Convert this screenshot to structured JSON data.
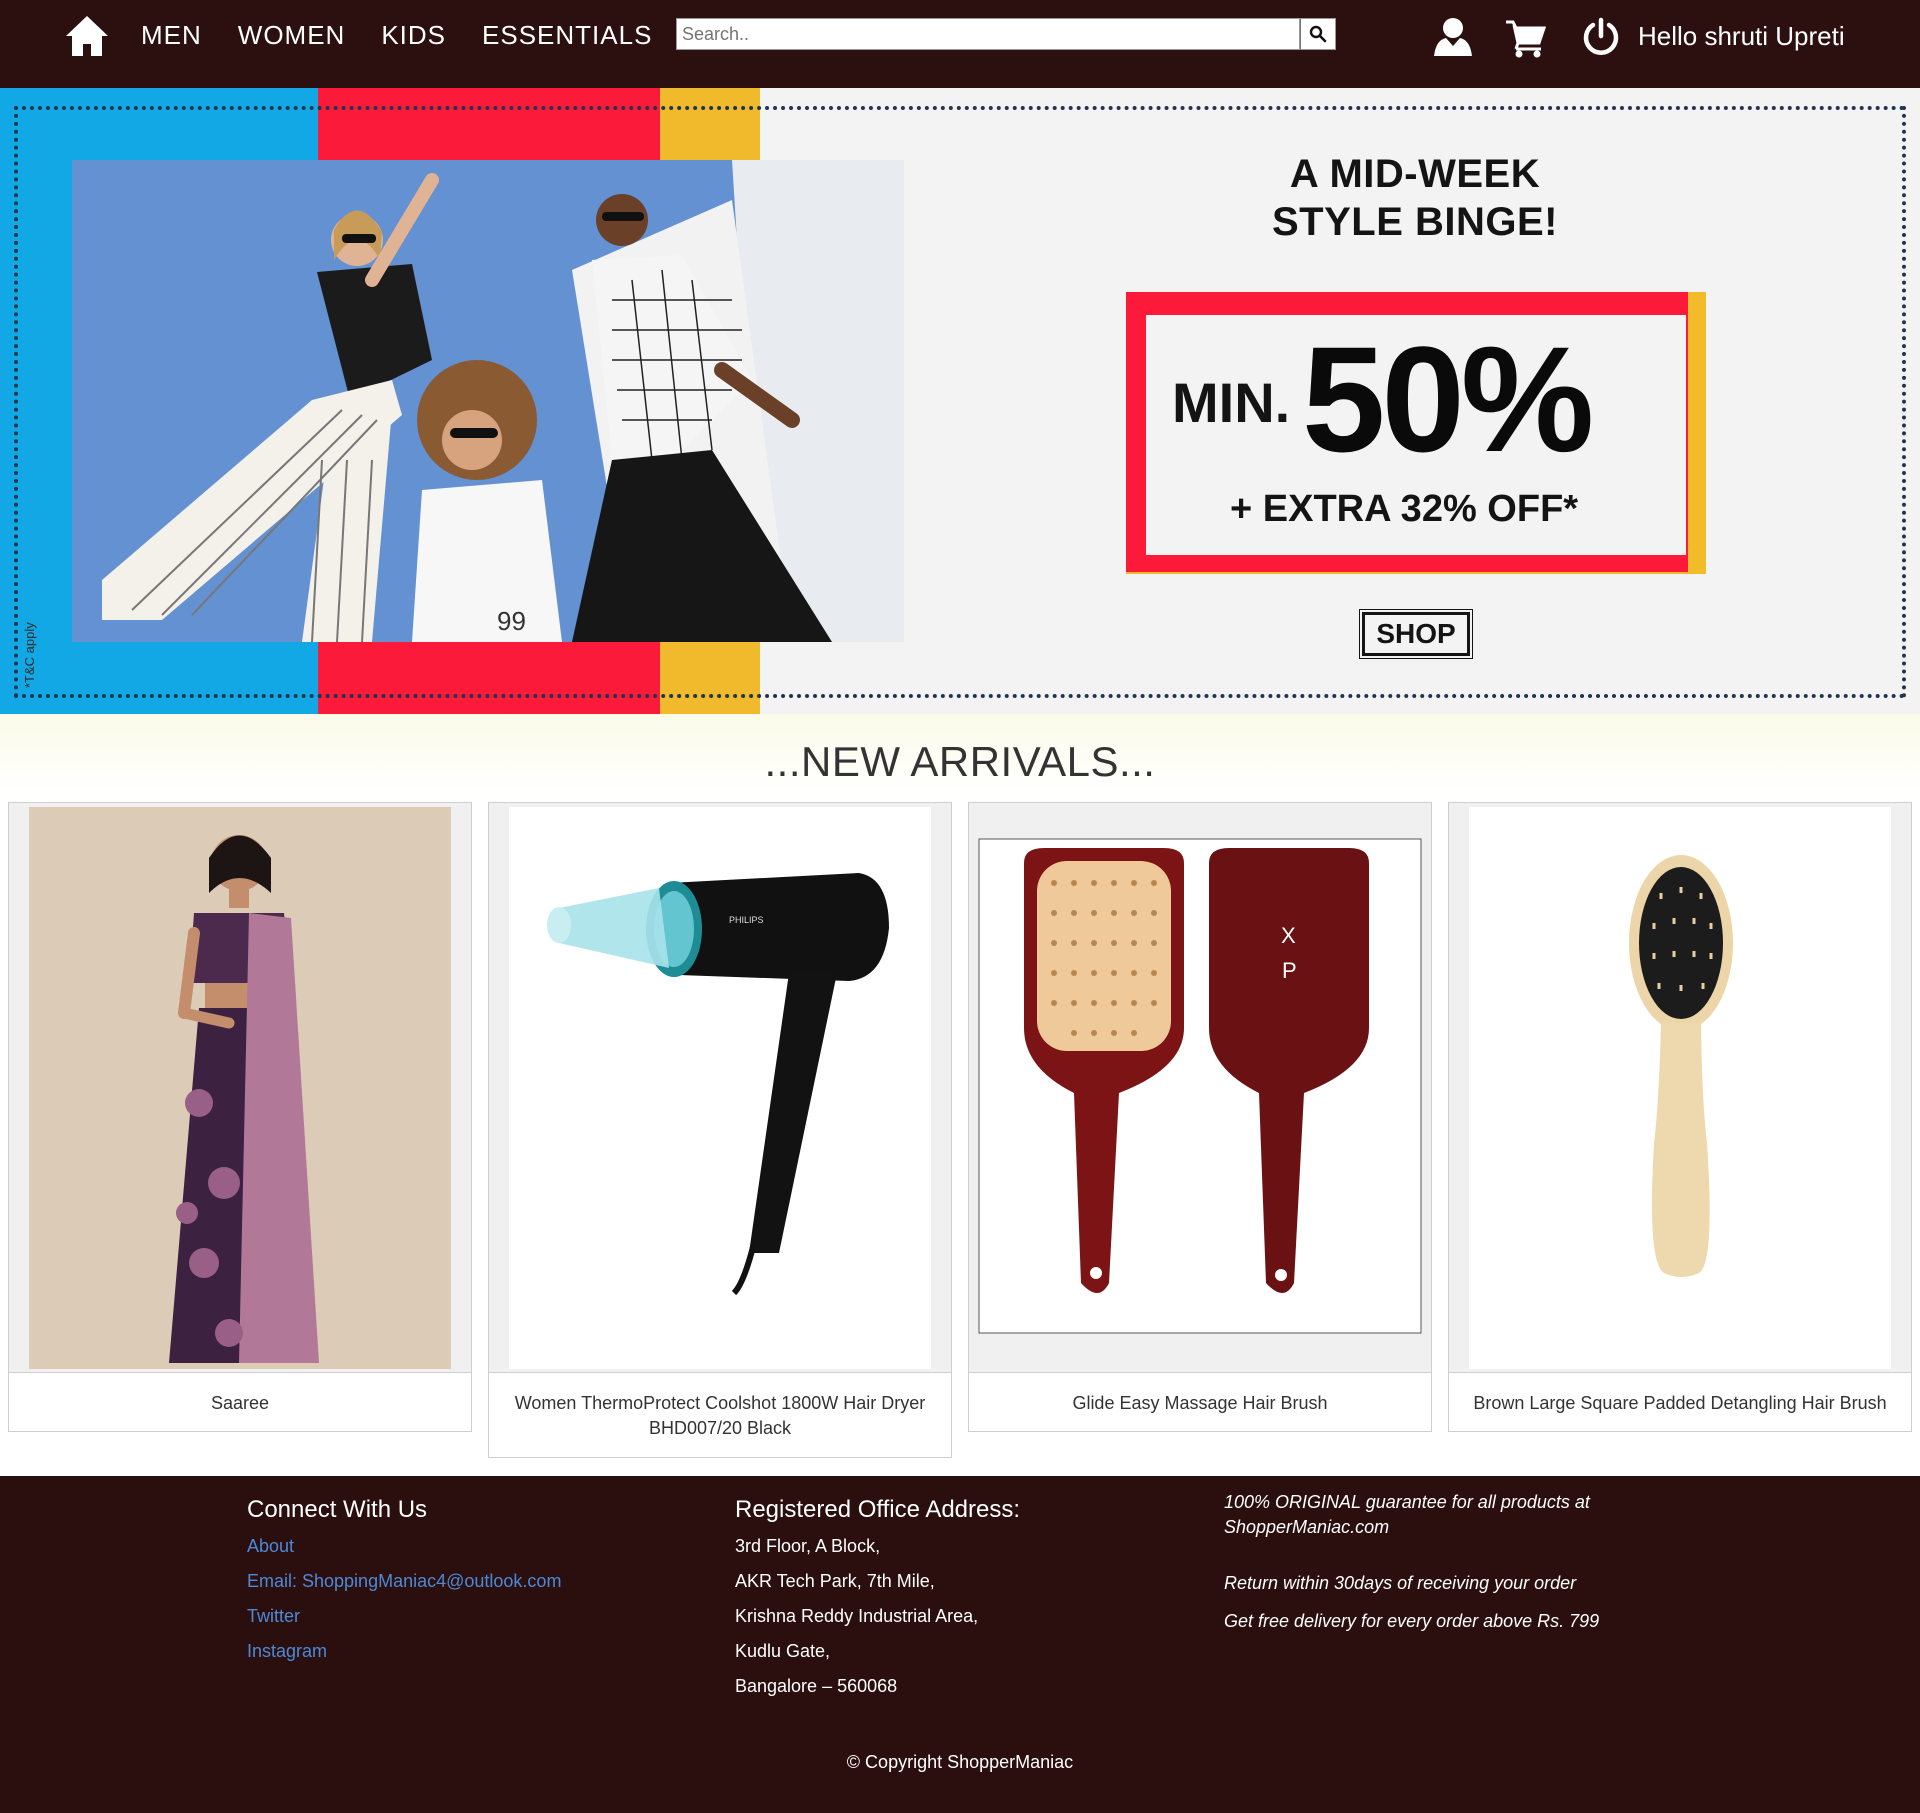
{
  "navbar": {
    "links": [
      "MEN",
      "WOMEN",
      "KIDS",
      "ESSENTIALS"
    ],
    "search_placeholder": "Search..",
    "greeting": "Hello shruti Upreti"
  },
  "banner": {
    "headline_line1": "A MID-WEEK",
    "headline_line2": "STYLE BINGE!",
    "offer_min": "MIN.",
    "offer_percent": "50%",
    "offer_extra": "+ EXTRA 32% OFF*",
    "shop_label": "SHOP",
    "tc_note": "*T&C apply",
    "stripe_colors": [
      "#12a8e6",
      "#fb1a3a",
      "#f1b92c"
    ]
  },
  "arrivals": {
    "title": "...NEW ARRIVALS...",
    "products": [
      {
        "name": "Saaree"
      },
      {
        "name": "Women ThermoProtect Coolshot 1800W Hair Dryer BHD007/20 Black"
      },
      {
        "name": "Glide Easy Massage Hair Brush"
      },
      {
        "name": "Brown Large Square Padded Detangling Hair Brush"
      }
    ]
  },
  "footer": {
    "connect_title": "Connect With Us",
    "links": [
      "About",
      "Email: ShoppingManiac4@outlook.com",
      "Twitter",
      "Instagram"
    ],
    "address_title": "Registered Office Address:",
    "address_lines": [
      "3rd Floor, A Block,",
      "AKR Tech Park, 7th Mile,",
      "Krishna Reddy Industrial Area,",
      "Kudlu Gate,",
      "Bangalore – 560068"
    ],
    "guarantee_line1": "100% ORIGINAL guarantee for all products at",
    "guarantee_line2": "ShopperManiac.com",
    "return_text": "Return within 30days of receiving your order",
    "delivery_text": "Get free delivery for every order above Rs. 799",
    "copyright": "© Copyright ShopperManiac"
  },
  "colors": {
    "navbar_bg": "#2c1010",
    "footer_bg": "#2b0f0f",
    "link_blue": "#4d89d6"
  },
  "icons": [
    "home-icon",
    "search-icon",
    "user-icon",
    "cart-icon",
    "power-icon"
  ]
}
